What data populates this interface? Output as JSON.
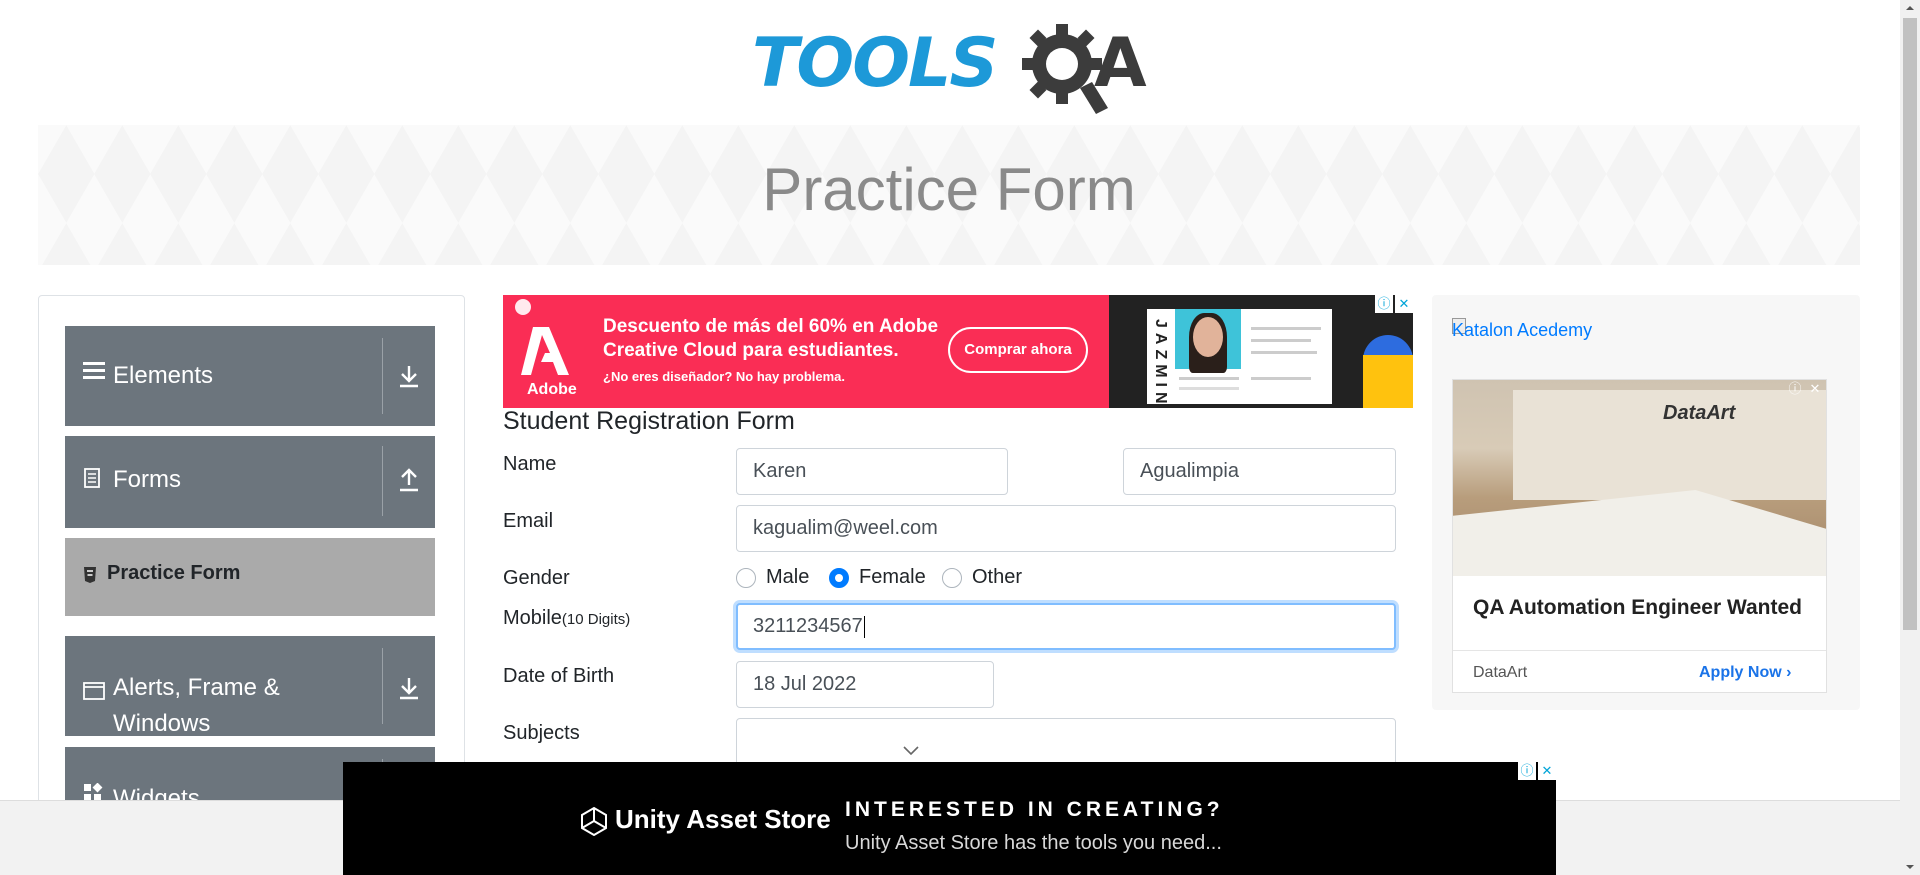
{
  "logo": {
    "tools_text": "TOOLS",
    "qa_text": "QA"
  },
  "banner": {
    "title": "Practice Form"
  },
  "sidebar": {
    "groups": [
      {
        "label": "Elements",
        "icon": "menu-icon",
        "arrow": "download-arrow-icon"
      },
      {
        "label": "Forms",
        "icon": "document-icon",
        "arrow": "upload-arrow-icon"
      },
      {
        "label": "Alerts, Frame & Windows",
        "icon": "window-icon",
        "arrow": "download-arrow-icon"
      },
      {
        "label": "Widgets",
        "icon": "widgets-icon",
        "arrow": "download-arrow-icon"
      }
    ],
    "active_item": {
      "label": "Practice Form",
      "icon": "html-icon"
    }
  },
  "ad_top": {
    "brand": "Adobe",
    "headline": "Descuento de más del 60% en Adobe Creative Cloud para estudiantes.",
    "subline": "¿No eres diseñador? No hay problema.",
    "cta": "Comprar ahora",
    "card_name": "JAZMIN"
  },
  "form": {
    "title": "Student Registration Form",
    "name_label": "Name",
    "first_name": "Karen",
    "last_name": "Agualimpia",
    "email_label": "Email",
    "email": "kagualim@weel.com",
    "gender_label": "Gender",
    "gender_options": [
      "Male",
      "Female",
      "Other"
    ],
    "gender_selected": "Female",
    "mobile_label": "Mobile",
    "mobile_hint": "(10 Digits)",
    "mobile": "3211234567",
    "dob_label": "Date of Birth",
    "dob": "18 Jul 2022",
    "subjects_label": "Subjects"
  },
  "ad_right": {
    "image_alt": "Katalon Acedemy",
    "office_logo": "DataArt",
    "title": "QA Automation Engineer Wanted",
    "brand": "DataArt",
    "cta": "Apply Now"
  },
  "ad_bottom": {
    "brand": "Unity Asset Store",
    "headline": "INTERESTED IN CREATING?",
    "subline": "Unity Asset Store has the tools you need..."
  },
  "colors": {
    "accent": "#007bff",
    "sidebar": "#6c757d",
    "adobe": "#fa2d55",
    "logo_blue": "#1d99d8"
  }
}
